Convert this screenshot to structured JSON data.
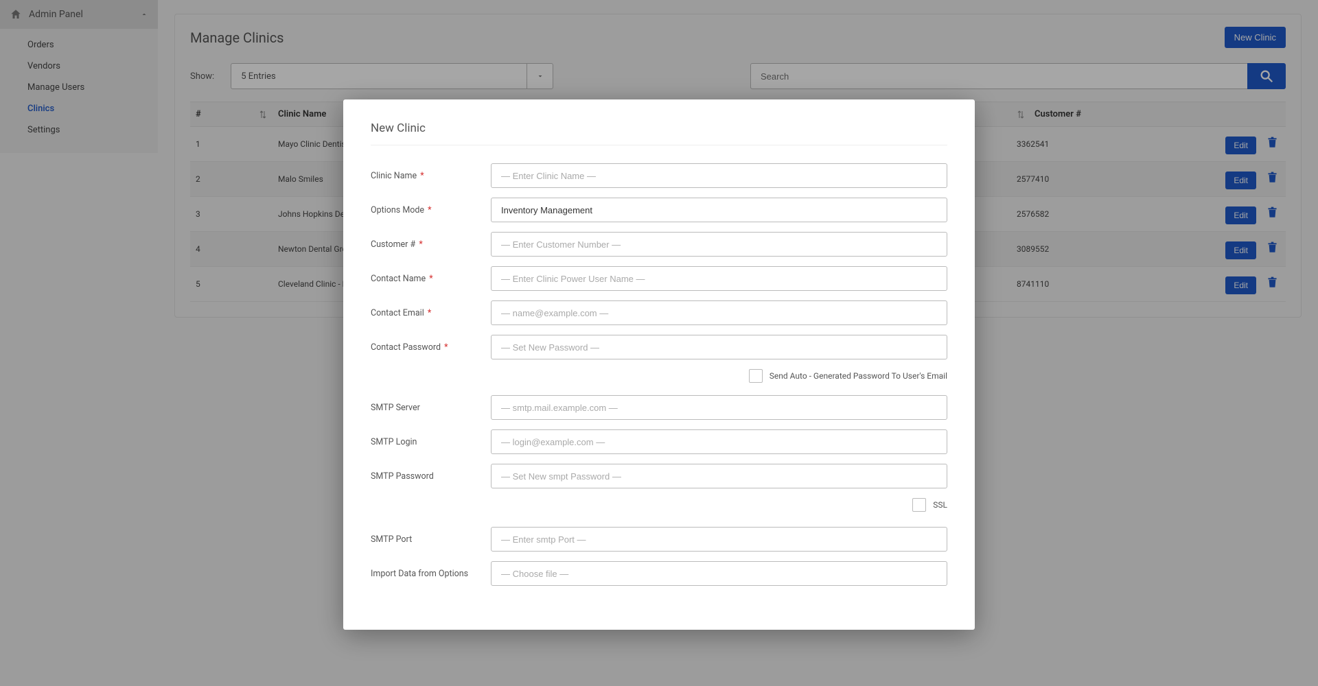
{
  "sidebar": {
    "title": "Admin Panel",
    "items": [
      {
        "label": "Orders",
        "active": false
      },
      {
        "label": "Vendors",
        "active": false
      },
      {
        "label": "Manage Users",
        "active": false
      },
      {
        "label": "Clinics",
        "active": true
      },
      {
        "label": "Settings",
        "active": false
      }
    ]
  },
  "page": {
    "title": "Manage Clinics",
    "new_button": "New Clinic"
  },
  "filters": {
    "show_label": "Show:",
    "entries_value": "5 Entries",
    "search_placeholder": "Search"
  },
  "table": {
    "columns": {
      "num": "#",
      "name": "Clinic Name",
      "customer": "Customer #"
    },
    "actions": {
      "edit": "Edit"
    },
    "rows": [
      {
        "num": "1",
        "name": "Mayo Clinic Dentistry",
        "customer": "3362541"
      },
      {
        "num": "2",
        "name": "Malo Smiles",
        "customer": "2577410"
      },
      {
        "num": "3",
        "name": "Johns Hopkins Dentistry",
        "customer": "2576582"
      },
      {
        "num": "4",
        "name": "Newton Dental Group",
        "customer": "3089552"
      },
      {
        "num": "5",
        "name": "Cleveland Clinic - Dental",
        "customer": "8741110"
      }
    ]
  },
  "modal": {
    "title": "New Clinic",
    "fields": {
      "clinic_name": {
        "label": "Clinic Name",
        "required": true,
        "placeholder": "— Enter Clinic Name —",
        "value": ""
      },
      "options_mode": {
        "label": "Options Mode",
        "required": true,
        "placeholder": "",
        "value": "Inventory Management"
      },
      "customer_num": {
        "label": "Customer #",
        "required": true,
        "placeholder": "— Enter Customer Number —",
        "value": ""
      },
      "contact_name": {
        "label": "Contact Name",
        "required": true,
        "placeholder": "— Enter Clinic Power User Name —",
        "value": ""
      },
      "contact_email": {
        "label": "Contact Email",
        "required": true,
        "placeholder": "— name@example.com —",
        "value": ""
      },
      "contact_password": {
        "label": "Contact Password",
        "required": true,
        "placeholder": "— Set New Password —",
        "value": ""
      },
      "auto_pwd_label": "Send Auto - Generated Password To User's Email",
      "smtp_server": {
        "label": "SMTP Server",
        "required": false,
        "placeholder": "— smtp.mail.example.com —",
        "value": ""
      },
      "smtp_login": {
        "label": "SMTP Login",
        "required": false,
        "placeholder": "— login@example.com —",
        "value": ""
      },
      "smtp_password": {
        "label": "SMTP Password",
        "required": false,
        "placeholder": "— Set New smpt Password —",
        "value": ""
      },
      "ssl_label": "SSL",
      "smtp_port": {
        "label": "SMTP Port",
        "required": false,
        "placeholder": "— Enter smtp Port —",
        "value": ""
      },
      "import": {
        "label": "Import Data from Options",
        "required": false,
        "placeholder": "— Choose file —",
        "value": ""
      }
    }
  }
}
